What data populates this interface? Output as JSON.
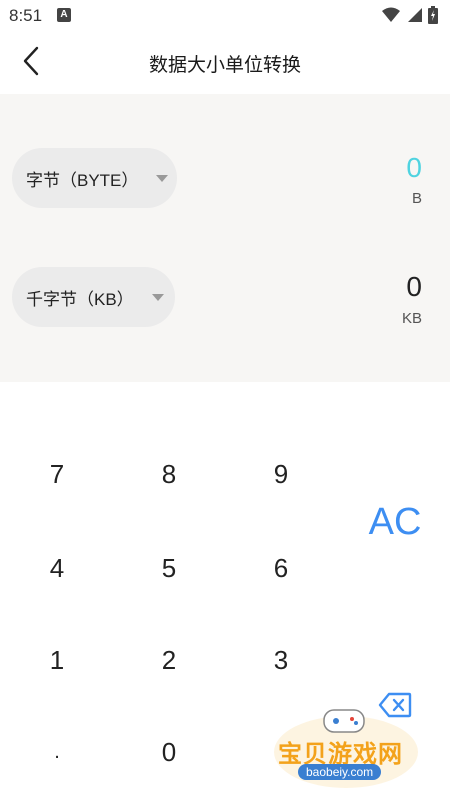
{
  "status": {
    "time": "8:51",
    "notif_letter": "A"
  },
  "header": {
    "title": "数据大小单位转换"
  },
  "converter": {
    "from": {
      "unit_label": "字节（BYTE）",
      "value": "0",
      "unit_abbr": "B",
      "value_color": "#4fd3e0"
    },
    "to": {
      "unit_label": "千字节（KB）",
      "value": "0",
      "unit_abbr": "KB"
    }
  },
  "keypad": {
    "keys": [
      "7",
      "8",
      "9",
      "4",
      "5",
      "6",
      "1",
      "2",
      "3",
      ".",
      "0"
    ],
    "clear_label": "AC",
    "accent": "#3d8ef2"
  },
  "watermark": {
    "text": "宝贝游戏网",
    "url": "baobeiy.com"
  }
}
